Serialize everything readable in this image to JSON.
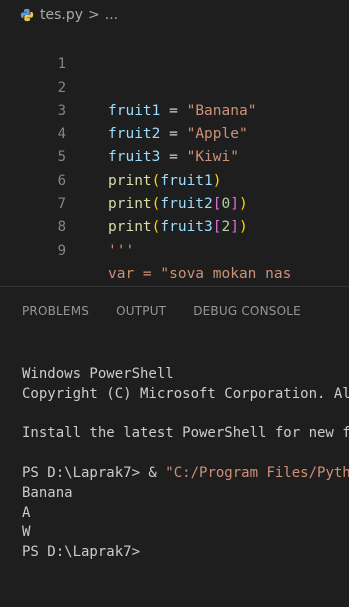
{
  "breadcrumb": {
    "file": "tes.py",
    "separator": ">",
    "rest": "..."
  },
  "editor": {
    "line_numbers": [
      "1",
      "2",
      "3",
      "4",
      "5",
      "6",
      "7",
      "8",
      "9"
    ],
    "lines": [
      {
        "var": "",
        "eq": "",
        "str": ""
      },
      {
        "var": "fruit1",
        "eq": " = ",
        "str": "\"Banana\""
      },
      {
        "var": "fruit2",
        "eq": " = ",
        "str": "\"Apple\""
      },
      {
        "var": "fruit3",
        "eq": " = ",
        "str": "\"Kiwi\""
      }
    ],
    "print_lines": [
      {
        "fn": "print",
        "open": "(",
        "arg": "fruit1",
        "close": ")"
      },
      {
        "fn": "print",
        "open": "(",
        "arg": "fruit2",
        "lb": "[",
        "idx": "0",
        "rb": "]",
        "close": ")"
      },
      {
        "fn": "print",
        "open": "(",
        "arg": "fruit3",
        "lb": "[",
        "idx": "2",
        "rb": "]",
        "close": ")"
      }
    ],
    "line8": "'''",
    "line9": "var = \"sova mokan nas"
  },
  "panel": {
    "tabs": [
      "PROBLEMS",
      "OUTPUT",
      "DEBUG CONSOLE"
    ]
  },
  "terminal": {
    "header1": "Windows PowerShell",
    "header2": "Copyright (C) Microsoft Corporation. All rights reserved.",
    "install": "Install the latest PowerShell for new features and improvements!",
    "prompt1": "PS D:\\Laprak7> & ",
    "cmd": "\"C:/Program Files/Python\"",
    "out1": "Banana",
    "out2": "A",
    "out3": "W",
    "prompt2": "PS D:\\Laprak7>"
  }
}
